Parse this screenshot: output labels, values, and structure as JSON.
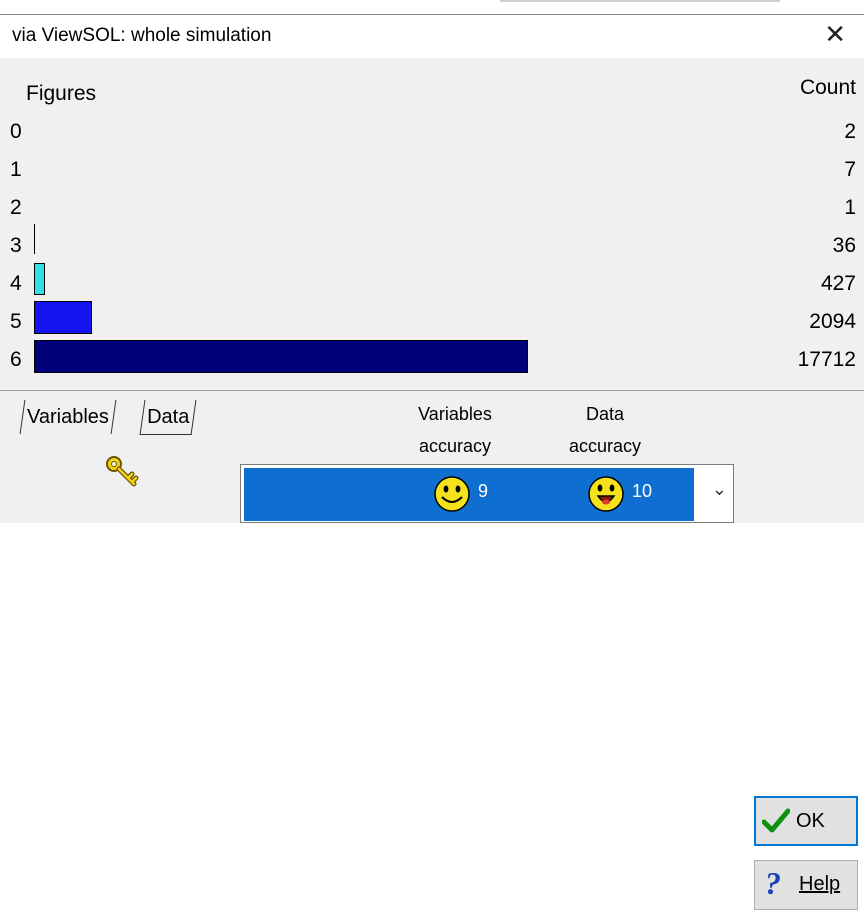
{
  "window": {
    "title": "via ViewSOL: whole simulation",
    "close_glyph": "✕"
  },
  "histogram": {
    "left_header": "Figures",
    "right_header": "Count",
    "rows": [
      {
        "figures": "0",
        "count": "2",
        "color": ""
      },
      {
        "figures": "1",
        "count": "7",
        "color": ""
      },
      {
        "figures": "2",
        "count": "1",
        "color": ""
      },
      {
        "figures": "3",
        "count": "36",
        "color": "#000000"
      },
      {
        "figures": "4",
        "count": "427",
        "color": "#33e0e8"
      },
      {
        "figures": "5",
        "count": "2094",
        "color": "#1414f0"
      },
      {
        "figures": "6",
        "count": "17712",
        "color": "#00007a"
      }
    ]
  },
  "tabs": {
    "variables": "Variables",
    "data": "Data"
  },
  "accuracy": {
    "variables_header_line1": "Variables",
    "variables_header_line2": "accuracy",
    "data_header_line1": "Data",
    "data_header_line2": "accuracy",
    "variables_value": "9",
    "data_value": "10"
  },
  "buttons": {
    "ok_label": "OK",
    "help_label": "Help"
  },
  "icons": {
    "key": "key-icon",
    "smiley": "smiley-icon",
    "check": "checkmark-icon",
    "help": "question-mark-icon",
    "dropdown": "chevron-down-icon"
  },
  "colors": {
    "selection": "#0f6fd0",
    "ok_border": "#0078d7"
  }
}
